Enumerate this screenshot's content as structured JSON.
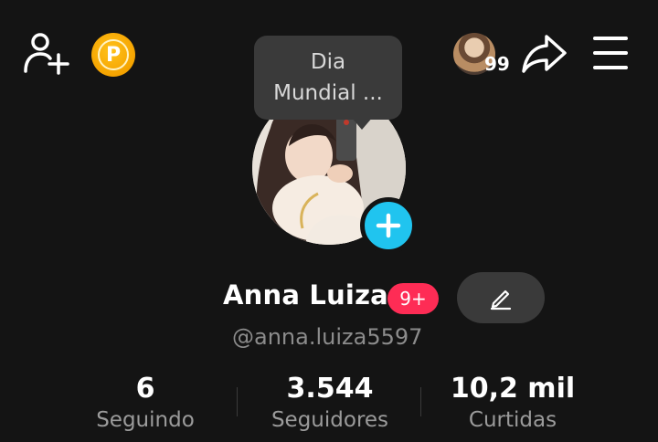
{
  "header": {
    "coin_letter": "P",
    "visitor_count": "99"
  },
  "tooltip": {
    "line1": "Dia",
    "line2": "Mundial ..."
  },
  "profile": {
    "name": "Anna Luiza",
    "badge": "9+",
    "handle": "@anna.luiza5597"
  },
  "stats": [
    {
      "value": "6",
      "label": "Seguindo"
    },
    {
      "value": "3.544",
      "label": "Seguidores"
    },
    {
      "value": "10,2 mil",
      "label": "Curtidas"
    }
  ],
  "colors": {
    "background": "#141414",
    "badge": "#fe2c55",
    "add_story": "#20c4ef",
    "coin": "#f5a300"
  },
  "icons": [
    "add-user-icon",
    "coin-icon",
    "share-icon",
    "menu-icon",
    "edit-pencil-icon",
    "plus-icon"
  ]
}
